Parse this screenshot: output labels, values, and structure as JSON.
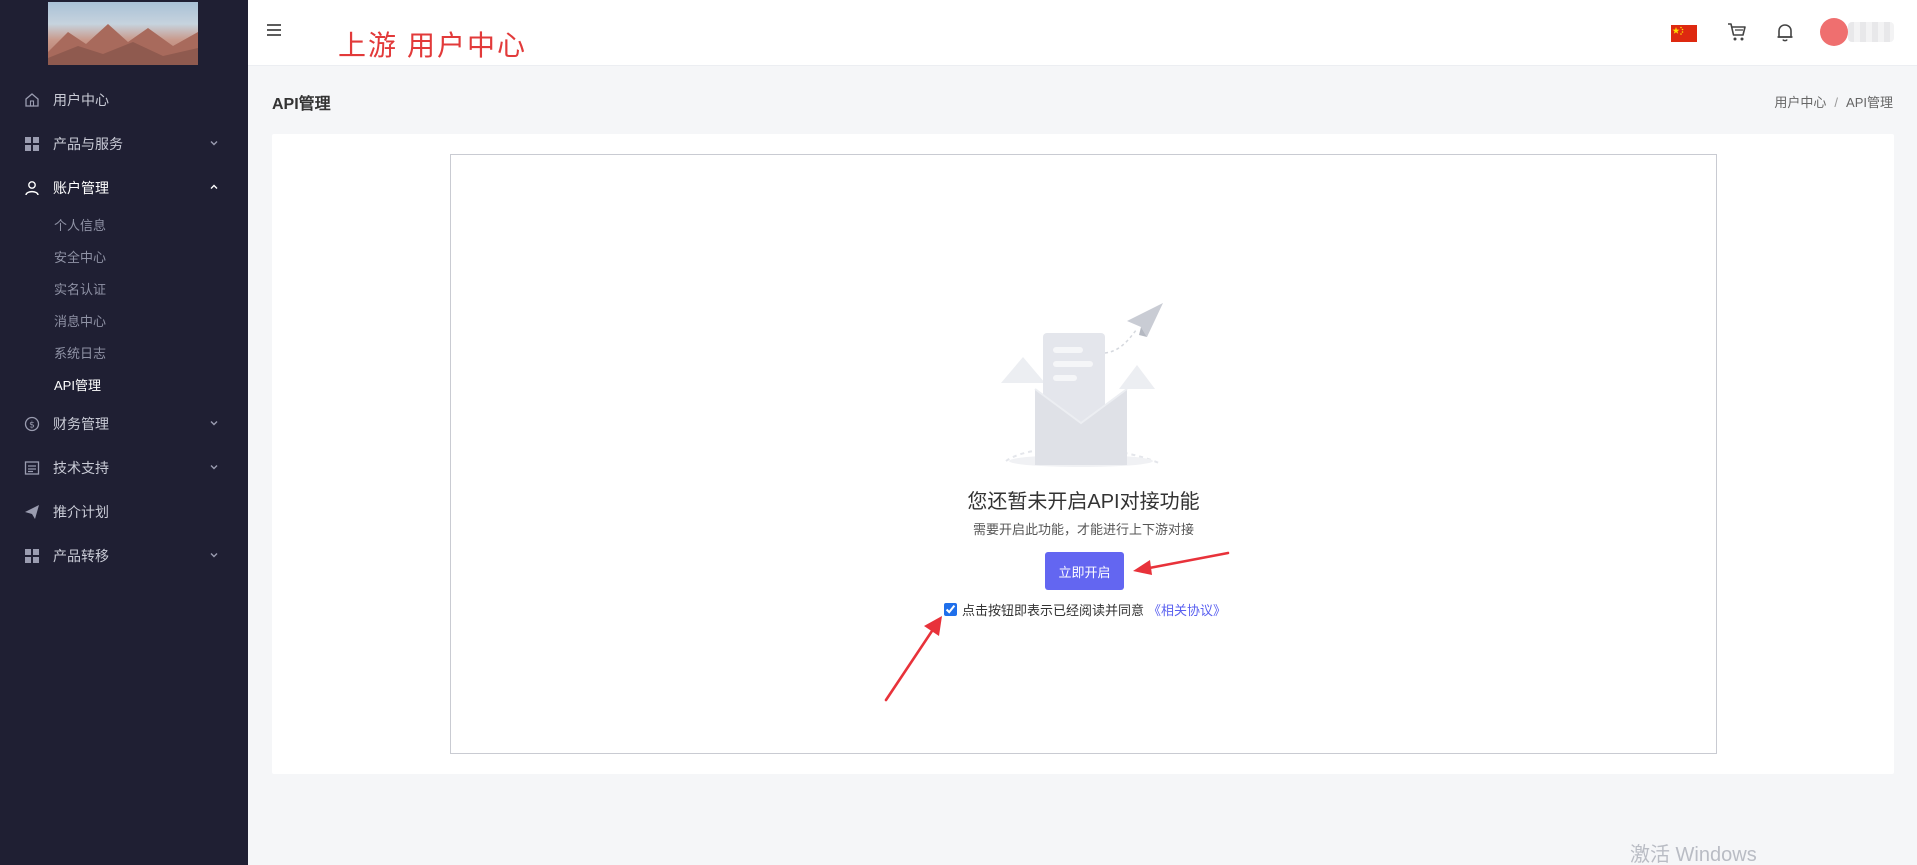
{
  "sidebar": {
    "items": [
      {
        "label": "用户中心",
        "icon": "home-icon"
      },
      {
        "label": "产品与服务",
        "icon": "grid-icon"
      },
      {
        "label": "账户管理",
        "icon": "user-icon"
      },
      {
        "label": "财务管理",
        "icon": "dollar-icon"
      },
      {
        "label": "技术支持",
        "icon": "document-icon"
      },
      {
        "label": "推介计划",
        "icon": "paper-plane-icon"
      },
      {
        "label": "产品转移",
        "icon": "grid-icon"
      }
    ],
    "account_sub": [
      "个人信息",
      "安全中心",
      "实名认证",
      "消息中心",
      "系统日志",
      "API管理"
    ]
  },
  "header": {
    "brand": "上游 用户中心",
    "flag": "china-flag-icon"
  },
  "page": {
    "title": "API管理",
    "breadcrumb": [
      "用户中心",
      "/",
      "API管理"
    ]
  },
  "empty_state": {
    "title": "您还暂未开启API对接功能",
    "subtitle": "需要开启此功能，才能进行上下游对接",
    "button": "立即开启",
    "agree_text": "点击按钮即表示已经阅读并同意",
    "agree_link": "《相关协议》",
    "agree_checked": true
  },
  "watermark": "激活 Windows",
  "colors": {
    "sidebar_bg": "#1f1f33",
    "accent": "#6366f1",
    "brand_red": "#e23a3a",
    "annotation_red": "#e8323a"
  }
}
